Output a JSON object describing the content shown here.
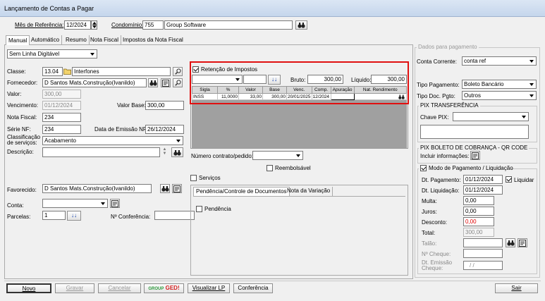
{
  "window": {
    "title": "Lançamento de Contas a Pagar"
  },
  "header": {
    "mes_label": "Mês de Referência:",
    "mes_value": "12/2024",
    "condominio_label": "Condomínio:",
    "condominio_code": "755",
    "condominio_name": "Group Software"
  },
  "tabs": [
    "Manual",
    "Automático",
    "Resumo",
    "Nota Fiscal",
    "Impostos da Nota Fiscal"
  ],
  "left": {
    "tipo_lancamento": "Sem Linha Digitável",
    "classe_label": "Classe:",
    "classe_code": "13.04",
    "classe_name": "Interfones",
    "fornecedor_label": "Fornecedor:",
    "fornecedor_value": "D Santos Mats.Construção(Ivanildo)",
    "valor_label": "Valor:",
    "valor_value": "300,00",
    "vencimento_label": "Vencimento:",
    "vencimento_value": "01/12/2024",
    "valor_base_label": "Valor Base:",
    "valor_base_value": "300,00",
    "nota_fiscal_label": "Nota Fiscal:",
    "nota_fiscal_value": "234",
    "serie_label": "Série NF:",
    "serie_value": "234",
    "emissao_label": "Data de Emissão NF:",
    "emissao_value": "26/12/2024",
    "classificacao_label1": "Classificação",
    "classificacao_label2": "de serviços:",
    "classificacao_value": "Acabamento",
    "descricao_label": "Descrição:",
    "favorecido_label": "Favorecido:",
    "favorecido_value": "D Santos Mats.Construção(Ivanildo)",
    "conta_label": "Conta:",
    "parcelas_label": "Parcelas:",
    "parcelas_value": "1",
    "conferencia_label": "Nº Conferência:"
  },
  "retencao": {
    "label": "Retenção de Impostos",
    "bruto_label": "Bruto:",
    "bruto_value": "300,00",
    "liquido_label": "Líquido:",
    "liquido_value": "300,00",
    "columns": [
      "Sigla",
      "%",
      "Valor",
      "Base",
      "Venc.",
      "Comp.",
      "Apuração",
      "Nat. Rendimento"
    ],
    "rows": [
      [
        "INSS",
        "11,0000",
        "33,00",
        "300,00",
        "20/01/2025",
        "12/2024",
        "",
        ""
      ]
    ]
  },
  "middle": {
    "contrato_label": "Número contrato/pedido:",
    "reembolsavel_label": "Reembolsável",
    "servicos_label": "Serviços",
    "subtabs": [
      "Pendência/Controle de Documentos",
      "Nota da Variação"
    ],
    "pendencia_label": "Pendência"
  },
  "pagamento": {
    "legend": "Dados para pagamento",
    "conta_corrente_label": "Conta Corrente:",
    "conta_corrente_value": "conta ref",
    "tipo_pagamento_label": "Tipo Pagamento:",
    "tipo_pagamento_value": "Boleto Bancário",
    "tipo_doc_label": "Tipo Doc. Pgto:",
    "tipo_doc_value": "Outros",
    "pix_legend": "PIX TRANSFERÊNCIA",
    "chave_pix_label": "Chave PIX:",
    "boleto_legend": "PIX BOLETO DE COBRANÇA - QR CODE",
    "incluir_label": "Incluir informações:",
    "modo_label": "Modo de Pagamento / Liquidação",
    "dt_pagamento_label": "Dt. Pagamento:",
    "dt_pagamento_value": "01/12/2024",
    "liquidar_label": "Liquidar",
    "dt_liquidacao_label": "Dt. Liquidação:",
    "dt_liquidacao_value": "01/12/2024",
    "multa_label": "Multa:",
    "multa_value": "0,00",
    "juros_label": "Juros:",
    "juros_value": "0,00",
    "desconto_label": "Desconto:",
    "desconto_value": "0,00",
    "total_label": "Total:",
    "total_value": "300,00",
    "talao_label": "Talão:",
    "cheque_label": "Nº Cheque:",
    "emissao_cheque_label1": "Dt. Emissão",
    "emissao_cheque_label2": "Cheque:",
    "emissao_cheque_value": "/ /"
  },
  "footer": {
    "novo": "Novo",
    "gravar": "Gravar",
    "cancelar": "Cancelar",
    "ged_a": "GROUP",
    "ged_b": "GED!",
    "visualizar": "Visualizar LP",
    "conferencia": "Conferência",
    "sair": "Sair"
  },
  "colors": {
    "highlight": "#e01010",
    "desconto": "#e00000"
  }
}
